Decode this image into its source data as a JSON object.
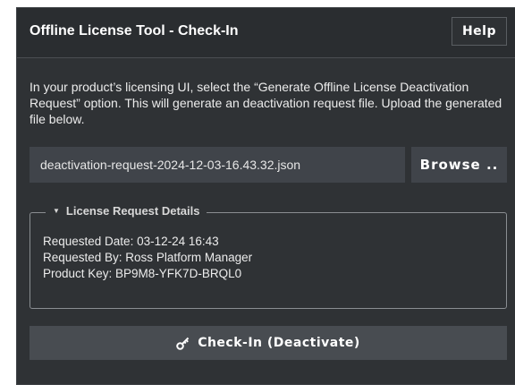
{
  "dialog": {
    "title": "Offline License Tool - Check-In",
    "help_label": "Help"
  },
  "instructions": "In your product’s licensing UI, select the “Generate Offline License Deactivation Request” option. This will generate an deactivation request file. Upload the generated file below.",
  "file_input": {
    "value": "deactivation-request-2024-12-03-16.43.32.json",
    "browse_label": "Browse .."
  },
  "details": {
    "legend": "License Request Details",
    "expanded": true,
    "lines": [
      "Requested Date: 03-12-24 16:43",
      "Requested By: Ross Platform Manager",
      "Product Key: BP9M8-YFK7D-BRQL0"
    ]
  },
  "action": {
    "label": "Check-In (Deactivate)",
    "icon": "key-icon"
  },
  "colors": {
    "panel": "#2f3235",
    "field": "#40444a",
    "button": "#484c51",
    "text": "#ffffff"
  }
}
